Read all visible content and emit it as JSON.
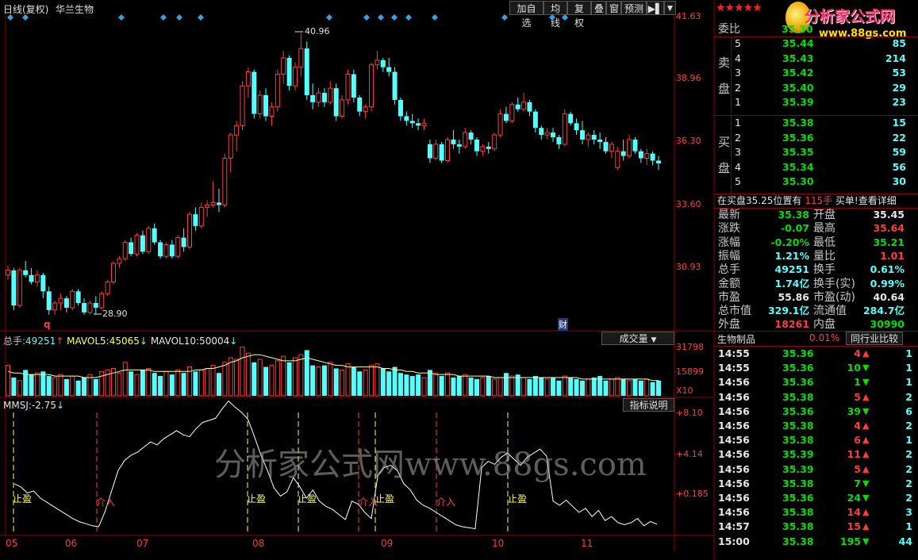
{
  "header": {
    "period_label": "日线(复权)",
    "stock_name": "华兰生物",
    "buttons": [
      "加自选",
      "均线",
      "复权",
      "叠",
      "窗",
      "预测"
    ],
    "nav_icon": "arrow-right-icon",
    "menu_icon": "dropdown-arrow-icon"
  },
  "logo": {
    "stars": "★★★★★",
    "brand": "分析家公式网",
    "url": "www.88gs.com"
  },
  "watermark": "分析家公式网www.88gs.com",
  "price_chart": {
    "y_ticks": [
      "41.63",
      "38.96",
      "36.30",
      "33.60",
      "30.93"
    ],
    "high_label": "40.96",
    "low_label": "28.90",
    "marker_q": "q",
    "marker_cai": "财",
    "candles": [
      [
        30.6,
        31.0,
        30.4,
        30.8
      ],
      [
        30.8,
        30.9,
        29.1,
        29.3
      ],
      [
        29.3,
        30.9,
        29.2,
        30.8
      ],
      [
        30.8,
        31.2,
        30.5,
        30.6
      ],
      [
        30.6,
        30.9,
        30.2,
        30.3
      ],
      [
        30.3,
        30.8,
        30.1,
        30.6
      ],
      [
        30.6,
        30.7,
        29.6,
        29.9
      ],
      [
        29.9,
        30.1,
        28.9,
        29.1
      ],
      [
        29.1,
        29.5,
        28.9,
        29.4
      ],
      [
        29.4,
        29.8,
        29.1,
        29.6
      ],
      [
        29.6,
        29.7,
        29.0,
        29.2
      ],
      [
        29.2,
        30.0,
        29.1,
        29.9
      ],
      [
        29.9,
        30.0,
        29.3,
        29.4
      ],
      [
        29.4,
        29.6,
        28.9,
        29.0
      ],
      [
        29.0,
        29.5,
        28.9,
        29.4
      ],
      [
        29.4,
        29.7,
        28.9,
        29.2
      ],
      [
        29.2,
        29.9,
        29.1,
        29.8
      ],
      [
        29.8,
        30.4,
        29.7,
        30.3
      ],
      [
        30.3,
        31.2,
        30.2,
        31.1
      ],
      [
        31.1,
        31.4,
        30.9,
        31.3
      ],
      [
        31.3,
        32.1,
        31.2,
        32.0
      ],
      [
        32.0,
        32.2,
        31.4,
        31.5
      ],
      [
        31.5,
        32.4,
        31.4,
        32.3
      ],
      [
        32.3,
        32.5,
        31.5,
        31.6
      ],
      [
        31.6,
        32.7,
        31.5,
        32.6
      ],
      [
        32.6,
        32.8,
        31.9,
        32.0
      ],
      [
        32.0,
        32.1,
        31.3,
        31.4
      ],
      [
        31.4,
        32.0,
        31.3,
        31.9
      ],
      [
        31.9,
        32.1,
        31.3,
        31.4
      ],
      [
        31.4,
        32.3,
        31.3,
        32.2
      ],
      [
        32.2,
        32.6,
        31.6,
        31.8
      ],
      [
        31.8,
        33.3,
        31.7,
        33.2
      ],
      [
        33.2,
        33.5,
        32.5,
        32.7
      ],
      [
        32.7,
        33.7,
        32.6,
        33.5
      ],
      [
        33.5,
        33.8,
        33.1,
        33.6
      ],
      [
        33.6,
        34.6,
        33.5,
        33.7
      ],
      [
        33.7,
        34.3,
        33.3,
        33.6
      ],
      [
        33.6,
        35.8,
        33.5,
        35.6
      ],
      [
        35.6,
        36.7,
        35.0,
        36.6
      ],
      [
        36.6,
        37.2,
        35.9,
        37.0
      ],
      [
        37.0,
        38.9,
        36.8,
        38.7
      ],
      [
        38.7,
        39.5,
        38.2,
        39.3
      ],
      [
        39.3,
        39.4,
        37.3,
        37.5
      ],
      [
        37.5,
        38.5,
        37.3,
        38.3
      ],
      [
        38.3,
        38.6,
        37.2,
        37.4
      ],
      [
        37.4,
        38.0,
        37.0,
        37.8
      ],
      [
        37.8,
        39.4,
        37.6,
        39.2
      ],
      [
        39.2,
        40.2,
        38.8,
        39.9
      ],
      [
        39.9,
        40.0,
        38.5,
        38.7
      ],
      [
        38.7,
        39.7,
        38.5,
        39.5
      ],
      [
        39.5,
        40.96,
        39.1,
        40.3
      ],
      [
        40.3,
        40.6,
        38.1,
        38.3
      ],
      [
        38.3,
        38.8,
        37.7,
        38.0
      ],
      [
        38.0,
        38.6,
        37.8,
        38.4
      ],
      [
        38.4,
        38.6,
        37.8,
        38.0
      ],
      [
        38.0,
        38.9,
        37.9,
        38.6
      ],
      [
        38.6,
        38.8,
        37.2,
        37.4
      ],
      [
        37.4,
        38.3,
        37.3,
        38.1
      ],
      [
        38.1,
        39.4,
        37.9,
        39.2
      ],
      [
        39.2,
        39.4,
        38.0,
        38.2
      ],
      [
        38.2,
        38.3,
        37.4,
        37.6
      ],
      [
        37.6,
        37.9,
        37.3,
        37.8
      ],
      [
        37.8,
        39.7,
        37.6,
        39.6
      ],
      [
        39.6,
        40.2,
        39.4,
        39.8
      ],
      [
        39.8,
        39.9,
        39.3,
        39.5
      ],
      [
        39.5,
        39.9,
        39.1,
        39.3
      ],
      [
        39.3,
        39.5,
        37.9,
        38.1
      ],
      [
        38.1,
        38.2,
        37.2,
        37.4
      ],
      [
        37.4,
        37.6,
        37.0,
        37.2
      ],
      [
        37.2,
        37.5,
        36.9,
        37.1
      ],
      [
        37.1,
        37.3,
        36.8,
        37.0
      ],
      [
        37.0,
        37.3,
        36.8,
        37.1
      ],
      [
        36.2,
        36.4,
        35.4,
        35.6
      ],
      [
        35.6,
        36.4,
        35.5,
        36.2
      ],
      [
        36.2,
        36.3,
        35.4,
        35.5
      ],
      [
        35.5,
        36.5,
        35.4,
        36.4
      ],
      [
        36.4,
        36.8,
        36.0,
        36.2
      ],
      [
        36.2,
        36.4,
        35.8,
        36.1
      ],
      [
        36.1,
        36.9,
        36.0,
        36.7
      ],
      [
        36.7,
        36.8,
        36.2,
        36.4
      ],
      [
        36.4,
        36.5,
        35.7,
        35.9
      ],
      [
        35.9,
        36.2,
        35.7,
        36.1
      ],
      [
        36.1,
        36.3,
        35.8,
        36.0
      ],
      [
        36.0,
        36.7,
        35.9,
        36.6
      ],
      [
        36.6,
        37.7,
        36.5,
        37.5
      ],
      [
        37.5,
        37.8,
        37.1,
        37.2
      ],
      [
        37.2,
        38.0,
        37.1,
        37.9
      ],
      [
        37.9,
        38.2,
        37.6,
        37.7
      ],
      [
        37.7,
        38.4,
        37.6,
        38.0
      ],
      [
        38.0,
        38.1,
        37.4,
        37.6
      ],
      [
        37.6,
        37.7,
        36.7,
        36.9
      ],
      [
        36.9,
        37.0,
        36.4,
        36.6
      ],
      [
        36.6,
        36.9,
        36.4,
        36.7
      ],
      [
        36.7,
        36.9,
        36.3,
        36.5
      ],
      [
        36.5,
        36.6,
        36.0,
        36.2
      ],
      [
        36.2,
        37.7,
        36.1,
        37.5
      ],
      [
        37.5,
        37.6,
        37.0,
        37.1
      ],
      [
        37.1,
        37.3,
        36.6,
        36.8
      ],
      [
        36.8,
        37.2,
        36.2,
        36.4
      ],
      [
        36.4,
        36.7,
        36.1,
        36.6
      ],
      [
        36.6,
        36.8,
        36.2,
        36.4
      ],
      [
        36.4,
        36.7,
        36.0,
        36.3
      ],
      [
        36.3,
        36.5,
        35.8,
        35.9
      ],
      [
        35.9,
        36.3,
        35.6,
        36.2
      ],
      [
        35.2,
        36.1,
        35.1,
        35.9
      ],
      [
        35.9,
        36.4,
        35.5,
        35.7
      ],
      [
        35.7,
        36.6,
        35.6,
        36.4
      ],
      [
        36.4,
        36.5,
        35.8,
        35.9
      ],
      [
        35.9,
        36.0,
        35.4,
        35.6
      ],
      [
        35.6,
        36.0,
        35.3,
        35.8
      ],
      [
        35.8,
        35.9,
        35.3,
        35.5
      ],
      [
        35.5,
        35.7,
        35.1,
        35.38
      ]
    ]
  },
  "volume": {
    "label_prefix": "总手:",
    "total": "49251",
    "mavol5_label": "MAVOL5:",
    "mavol5": "45065",
    "mavol10_label": "MAVOL10:",
    "mavol10": "50004",
    "dropdown_label": "成交量",
    "y_ticks": [
      "31798",
      "15899"
    ],
    "unit": "X10",
    "bars": [
      20,
      12,
      10,
      17,
      14,
      15,
      16,
      13,
      12,
      14,
      11,
      13,
      10,
      12,
      14,
      11,
      16,
      17,
      18,
      15,
      22,
      16,
      14,
      17,
      18,
      15,
      13,
      16,
      14,
      17,
      15,
      19,
      16,
      17,
      18,
      20,
      15,
      22,
      25,
      24,
      32,
      28,
      22,
      24,
      19,
      20,
      23,
      26,
      22,
      25,
      27,
      30,
      20,
      19,
      20,
      22,
      18,
      17,
      21,
      19,
      16,
      17,
      20,
      21,
      18,
      16,
      19,
      15,
      14,
      13,
      14,
      12,
      17,
      15,
      13,
      15,
      12,
      13,
      14,
      12,
      11,
      12,
      13,
      11,
      12,
      15,
      13,
      14,
      12,
      11,
      13,
      12,
      11,
      12,
      10,
      13,
      12,
      11,
      10,
      11,
      12,
      13,
      10,
      11,
      12,
      11,
      10,
      11,
      10,
      11,
      9,
      10
    ],
    "ma_line": [
      16,
      15,
      15,
      14,
      14,
      14,
      14,
      14,
      13,
      13,
      13,
      13,
      13,
      12,
      12,
      12,
      13,
      14,
      15,
      16,
      17,
      17,
      17,
      17,
      17,
      16,
      16,
      16,
      16,
      16,
      16,
      16,
      17,
      17,
      18,
      18,
      19,
      20,
      22,
      23,
      25,
      26,
      27,
      27,
      26,
      25,
      24,
      23,
      23,
      23,
      24,
      25,
      24,
      23,
      22,
      21,
      20,
      20,
      19,
      19,
      19,
      19,
      19,
      19,
      18,
      18,
      17,
      17,
      16,
      16,
      15,
      15,
      15,
      14,
      14,
      14,
      14,
      13,
      13,
      13,
      13,
      13,
      13,
      12,
      12,
      12,
      12,
      12,
      12,
      12,
      12,
      12,
      12,
      12,
      12,
      12,
      12,
      12,
      11,
      11,
      11,
      11,
      11,
      11,
      11,
      11,
      11,
      11,
      11,
      11,
      10,
      10
    ]
  },
  "indicator": {
    "name": "MMSJ:",
    "value": "-2.75",
    "explain_label": "指标说明",
    "y_ticks": [
      "+8.10",
      "+4.14",
      "+0.185"
    ],
    "signals": [
      {
        "label": "止盈",
        "color": "#ffff50"
      },
      {
        "label": "介入",
        "color": "#ff3c3c"
      },
      {
        "label": "止盈",
        "color": "#ffff50"
      },
      {
        "label": "止盈",
        "color": "#ffff50"
      },
      {
        "label": "介入",
        "color": "#ff3c3c"
      },
      {
        "label": "止盈",
        "color": "#ffff50"
      },
      {
        "label": "介入",
        "color": "#ff3c3c"
      },
      {
        "label": "止盈",
        "color": "#ffff50"
      }
    ],
    "line": [
      1.2,
      0.9,
      0.3,
      0.5,
      -0.2,
      -0.6,
      -1.0,
      -1.4,
      -1.8,
      -2.2,
      -2.5,
      -2.7,
      -2.9,
      -3.0,
      -1.5,
      0.5,
      2.5,
      3.5,
      4.0,
      4.3,
      4.8,
      5.3,
      5.0,
      5.6,
      6.0,
      6.4,
      6.0,
      5.8,
      6.6,
      7.2,
      7.4,
      7.6,
      8.5,
      9.3,
      8.7,
      8.2,
      7.5,
      5.8,
      4.0,
      2.5,
      0.8,
      0.0,
      0.4,
      1.8,
      0.9,
      -0.2,
      0.6,
      -0.5,
      -1.0,
      -1.3,
      -1.8,
      -2.3,
      -0.5,
      -0.8,
      -1.6,
      -2.2,
      2.0,
      2.8,
      3.0,
      2.5,
      1.2,
      0.6,
      -0.4,
      -0.9,
      -1.2,
      -1.6,
      -2.0,
      -2.4,
      -2.8,
      -3.0,
      -3.1,
      -3.2,
      2.8,
      3.4,
      3.1,
      3.8,
      4.2,
      3.6,
      3.0,
      3.8,
      4.2,
      4.6,
      3.9,
      -0.5,
      -0.9,
      -0.4,
      -1.0,
      -1.6,
      -1.2,
      -2.0,
      -1.4,
      -2.4,
      -2.0,
      -2.6,
      -2.8,
      -2.6,
      -2.2,
      -2.9,
      -2.5,
      -2.75
    ]
  },
  "x_axis": [
    "05",
    "06",
    "07",
    "08",
    "09",
    "10",
    "11"
  ],
  "order_book": {
    "title": "委比",
    "ratio": "35.30",
    "sell_label_chars": [
      "卖",
      "盘"
    ],
    "buy_label_chars": [
      "买",
      "盘"
    ],
    "sell": [
      {
        "level": "5",
        "price": "35.44",
        "vol": "85"
      },
      {
        "level": "4",
        "price": "35.43",
        "vol": "214"
      },
      {
        "level": "3",
        "price": "35.42",
        "vol": "53"
      },
      {
        "level": "2",
        "price": "35.40",
        "vol": "29"
      },
      {
        "level": "1",
        "price": "35.39",
        "vol": "23"
      }
    ],
    "buy": [
      {
        "level": "1",
        "price": "35.38",
        "vol": "15"
      },
      {
        "level": "2",
        "price": "35.36",
        "vol": "22"
      },
      {
        "level": "3",
        "price": "35.35",
        "vol": "59"
      },
      {
        "level": "4",
        "price": "35.34",
        "vol": "56"
      },
      {
        "level": "5",
        "price": "35.30",
        "vol": "30"
      }
    ],
    "notice_a": "在买盘35.25位置有",
    "notice_qty": "115手",
    "notice_b": "买单!",
    "notice_link": "查看详细"
  },
  "quote": [
    {
      "l1": "最新",
      "v1": "35.38",
      "c1": "#00e000",
      "l2": "开盘",
      "v2": "35.45",
      "c2": "#e6e6e6"
    },
    {
      "l1": "涨跌",
      "v1": "-0.07",
      "c1": "#00e000",
      "l2": "最高",
      "v2": "35.64",
      "c2": "#ff3c3c"
    },
    {
      "l1": "涨幅",
      "v1": "-0.20%",
      "c1": "#00e000",
      "l2": "最低",
      "v2": "35.21",
      "c2": "#00e000"
    },
    {
      "l1": "振幅",
      "v1": "1.21%",
      "c1": "#54ffff",
      "l2": "量比",
      "v2": "1.01",
      "c2": "#ff3c3c"
    },
    {
      "l1": "总手",
      "v1": "49251",
      "c1": "#54ffff",
      "l2": "换手",
      "v2": "0.61%",
      "c2": "#54ffff"
    },
    {
      "l1": "金额",
      "v1": "1.74亿",
      "c1": "#54ffff",
      "l2": "换手(实)",
      "v2": "0.99%",
      "c2": "#54ffff"
    },
    {
      "l1": "市盈",
      "v1": "55.86",
      "c1": "#e6e6e6",
      "l2": "市盈(动)",
      "v2": "40.64",
      "c2": "#e6e6e6"
    },
    {
      "l1": "总市值",
      "v1": "329.1亿",
      "c1": "#54ffff",
      "l2": "流通值",
      "v2": "284.7亿",
      "c2": "#54ffff"
    },
    {
      "l1": "外盘",
      "v1": "18261",
      "c1": "#ff3c3c",
      "l2": "内盘",
      "v2": "30990",
      "c2": "#00e000"
    }
  ],
  "industry": {
    "name": "生物制品",
    "change": "0.01%",
    "compare_label": "同行业比较"
  },
  "ticks": [
    {
      "t": "14:55",
      "p": "35.36",
      "v": "4",
      "d": "up",
      "n": "1"
    },
    {
      "t": "14:55",
      "p": "35.36",
      "v": "10",
      "d": "down",
      "n": "1"
    },
    {
      "t": "14:56",
      "p": "35.36",
      "v": "1",
      "d": "down",
      "n": "1"
    },
    {
      "t": "14:56",
      "p": "35.38",
      "v": "5",
      "d": "up",
      "n": "2"
    },
    {
      "t": "14:56",
      "p": "35.36",
      "v": "39",
      "d": "down",
      "n": "6"
    },
    {
      "t": "14:56",
      "p": "35.38",
      "v": "4",
      "d": "up",
      "n": "2"
    },
    {
      "t": "14:56",
      "p": "35.38",
      "v": "6",
      "d": "up",
      "n": "1"
    },
    {
      "t": "14:56",
      "p": "35.39",
      "v": "11",
      "d": "up",
      "n": "2"
    },
    {
      "t": "14:56",
      "p": "35.39",
      "v": "5",
      "d": "up",
      "n": "2"
    },
    {
      "t": "14:56",
      "p": "35.38",
      "v": "7",
      "d": "down",
      "n": "2"
    },
    {
      "t": "14:56",
      "p": "35.36",
      "v": "24",
      "d": "down",
      "n": "2"
    },
    {
      "t": "14:56",
      "p": "35.38",
      "v": "14",
      "d": "up",
      "n": "3"
    },
    {
      "t": "14:57",
      "p": "35.38",
      "v": "15",
      "d": "up",
      "n": "1"
    },
    {
      "t": "15:00",
      "p": "35.38",
      "v": "195",
      "d": "down",
      "n": "44"
    }
  ],
  "colors": {
    "up": "#ff3c3c",
    "down": "#54ffff",
    "grid": "#8b0000"
  }
}
